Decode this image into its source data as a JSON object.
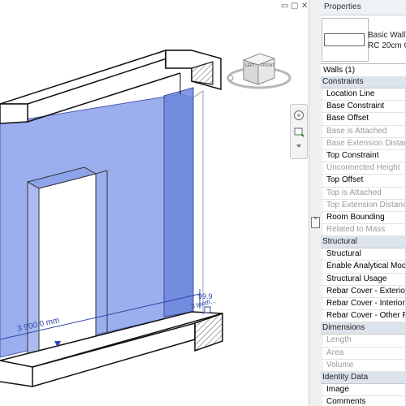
{
  "window": {
    "controls": [
      "▭",
      "▢",
      "✕"
    ]
  },
  "viewcube": {
    "faces": [
      "LEFT",
      "FRONT"
    ]
  },
  "dimension": {
    "length_label": "3 900.0 mm",
    "depth_value": "99.9",
    "depth_suffix": "3 tooth..."
  },
  "properties": {
    "title": "Properties",
    "type_name_line1": "Basic Wall",
    "type_name_line2": "RC 20cm C",
    "instance_filter": "Walls (1)",
    "groups": [
      {
        "name": "Constraints",
        "rows": [
          {
            "label": "Location Line",
            "disabled": false
          },
          {
            "label": "Base Constraint",
            "disabled": false
          },
          {
            "label": "Base Offset",
            "disabled": false
          },
          {
            "label": "Base is Attached",
            "disabled": true
          },
          {
            "label": "Base Extension Distance",
            "disabled": true
          },
          {
            "label": "Top Constraint",
            "disabled": false
          },
          {
            "label": "Unconnected Height",
            "disabled": true
          },
          {
            "label": "Top Offset",
            "disabled": false
          },
          {
            "label": "Top is Attached",
            "disabled": true
          },
          {
            "label": "Top Extension Distance",
            "disabled": true
          },
          {
            "label": "Room Bounding",
            "disabled": false
          },
          {
            "label": "Related to Mass",
            "disabled": true
          }
        ]
      },
      {
        "name": "Structural",
        "rows": [
          {
            "label": "Structural",
            "disabled": false
          },
          {
            "label": "Enable Analytical Model",
            "disabled": false
          },
          {
            "label": "Structural Usage",
            "disabled": false
          },
          {
            "label": "Rebar Cover - Exterior F",
            "disabled": false
          },
          {
            "label": "Rebar Cover - Interior F",
            "disabled": false
          },
          {
            "label": "Rebar Cover - Other Fac",
            "disabled": false
          }
        ]
      },
      {
        "name": "Dimensions",
        "rows": [
          {
            "label": "Length",
            "disabled": true
          },
          {
            "label": "Area",
            "disabled": true
          },
          {
            "label": "Volume",
            "disabled": true
          }
        ]
      },
      {
        "name": "Identity Data",
        "rows": [
          {
            "label": "Image",
            "disabled": false
          },
          {
            "label": "Comments",
            "disabled": false
          }
        ]
      }
    ]
  },
  "colors": {
    "selection_fill": "#7f97e8",
    "edge": "#1a1a1a",
    "group_bg": "#dde3ec"
  }
}
